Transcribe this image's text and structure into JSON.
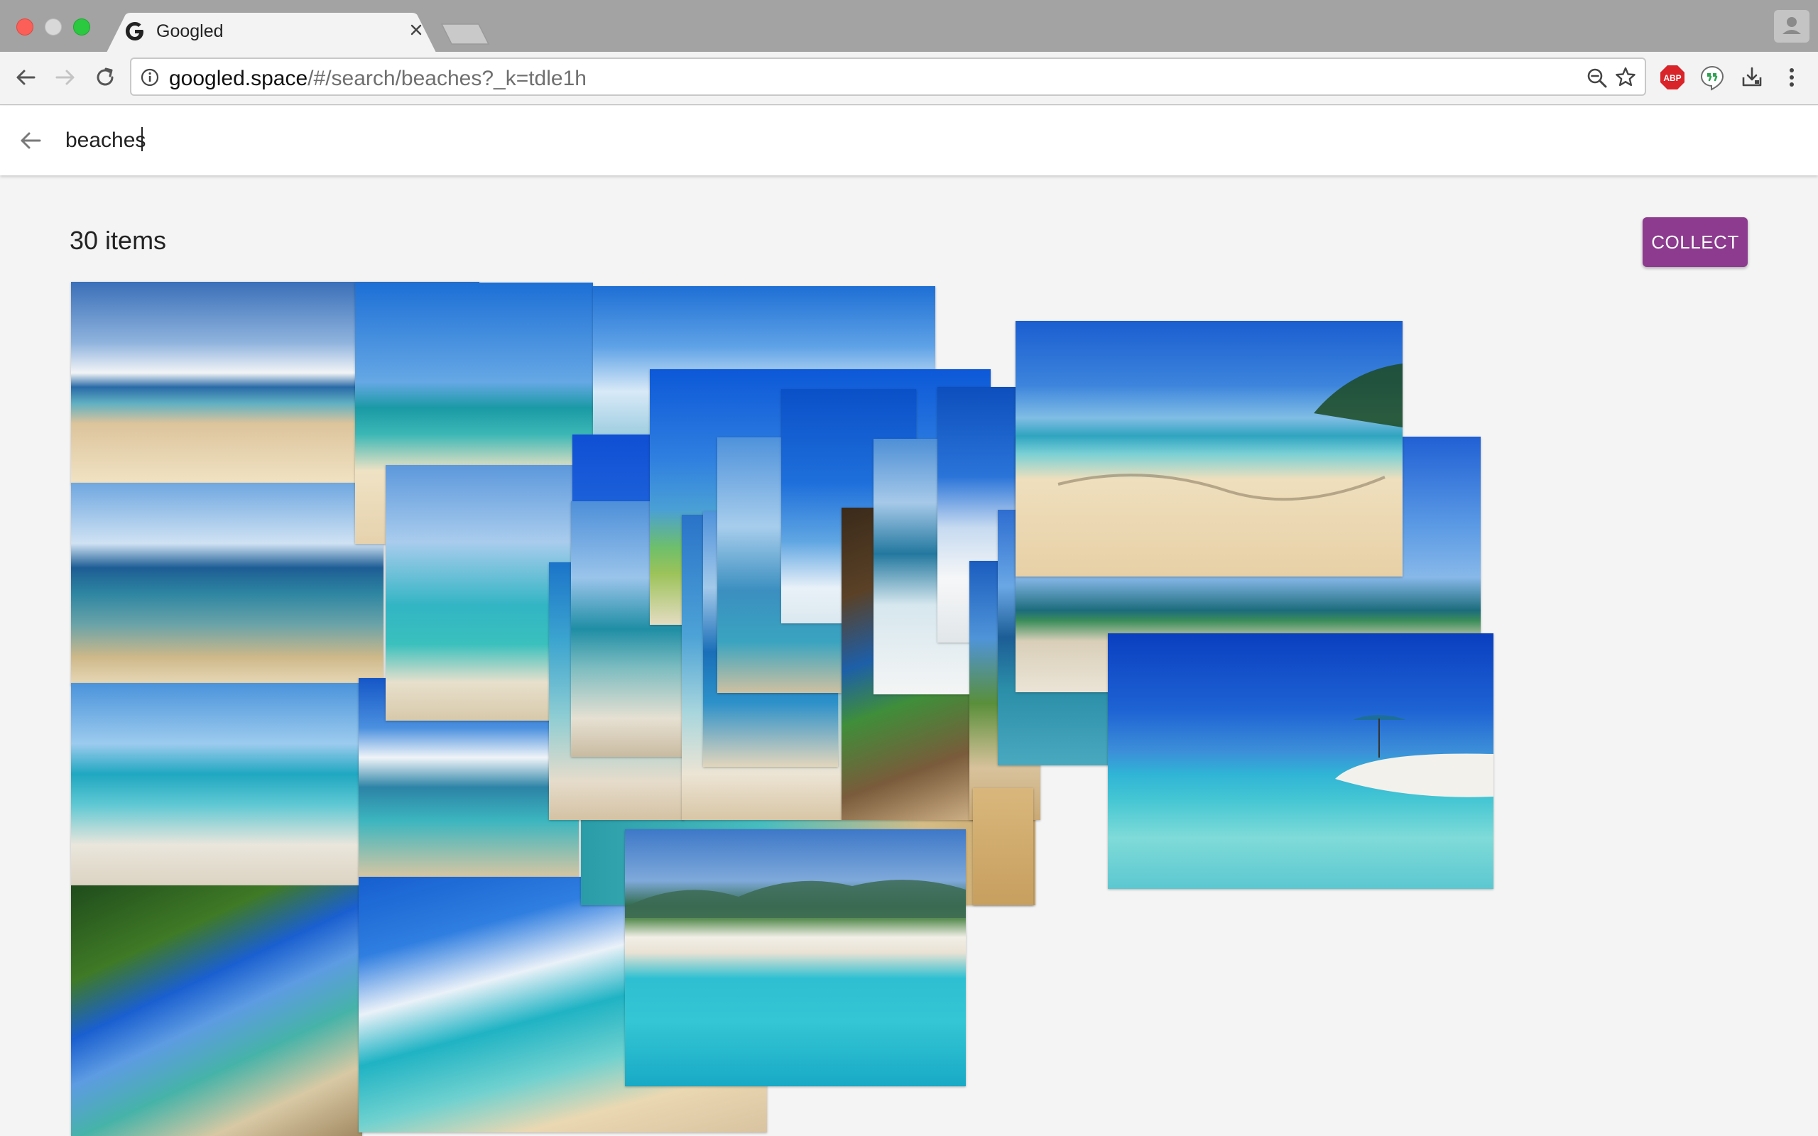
{
  "browser": {
    "tab_title": "Googled",
    "url_host": "googled.space",
    "url_path": "/#/search/beaches?_k=tdle1h",
    "extensions": {
      "abp_label": "ABP"
    }
  },
  "search": {
    "query": "beaches"
  },
  "results": {
    "count_label": "30 items",
    "collect_label": "COLLECT"
  },
  "colors": {
    "accent": "#8c3b8e",
    "sky": "#2f7fe0",
    "sea": "#36c2c9",
    "sand": "#ecd9b4"
  }
}
